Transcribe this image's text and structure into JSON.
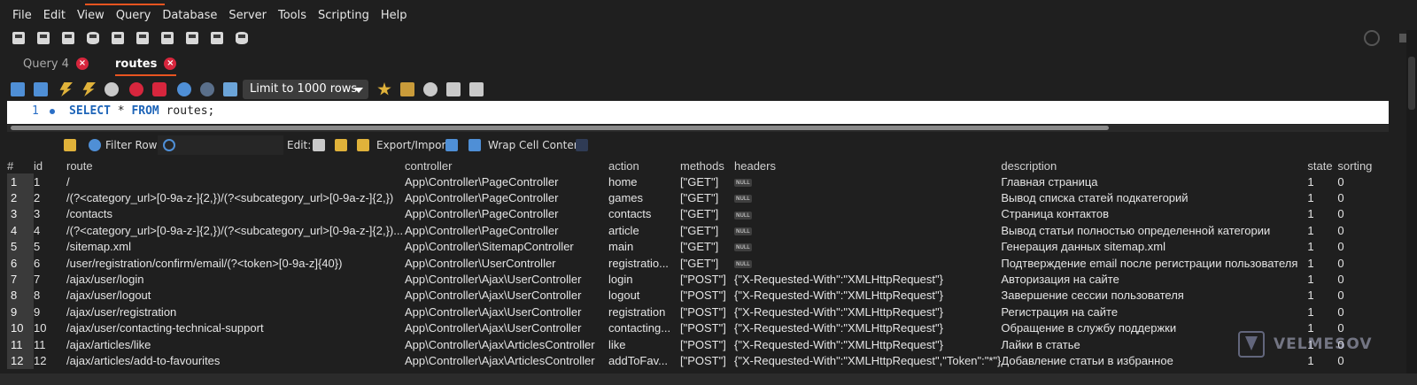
{
  "menu": [
    "File",
    "Edit",
    "View",
    "Query",
    "Database",
    "Server",
    "Tools",
    "Scripting",
    "Help"
  ],
  "main_toolbar_icons": [
    "new-sql-tab-icon",
    "open-sql-icon",
    "inspector-icon",
    "create-schema-icon",
    "create-table-icon",
    "create-view-icon",
    "create-procedure-icon",
    "create-function-icon",
    "search-table-icon",
    "reconnect-icon"
  ],
  "tabs": [
    {
      "label": "Query 4",
      "active": false
    },
    {
      "label": "routes",
      "active": true
    }
  ],
  "query_toolbar": {
    "icons": [
      "open-file-icon",
      "save-file-icon",
      "execute-icon",
      "execute-current-icon",
      "explain-icon",
      "stop-icon",
      "toggle-error-icon",
      "commit-icon",
      "rollback-icon",
      "autocommit-icon"
    ],
    "limit_label": "Limit to 1000 rows",
    "after_icons": [
      "beautify-icon",
      "find-replace-icon",
      "search-icon",
      "invisible-chars-icon",
      "wrap-icon"
    ]
  },
  "editor": {
    "line_number": "1",
    "kw1": "SELECT",
    "star": " * ",
    "kw2": "FROM",
    "rest": " routes;"
  },
  "result_toolbar": {
    "filter_label": "Filter Rows:",
    "edit_label": "Edit:",
    "export_label": "Export/Import:",
    "wrap_label": "Wrap Cell Content:"
  },
  "columns": [
    "#",
    "id",
    "route",
    "controller",
    "action",
    "methods",
    "headers",
    "description",
    "state",
    "sorting"
  ],
  "rows": [
    {
      "n": "1",
      "id": "1",
      "route": "/",
      "controller": "App\\Controller\\PageController",
      "action": "home",
      "methods": "[\"GET\"]",
      "headers": "NULL",
      "description": "Главная страница",
      "state": "1",
      "sorting": "0"
    },
    {
      "n": "2",
      "id": "2",
      "route": "/(?<category_url>[0-9a-z-]{2,})/(?<subcategory_url>[0-9a-z-]{2,})",
      "controller": "App\\Controller\\PageController",
      "action": "games",
      "methods": "[\"GET\"]",
      "headers": "NULL",
      "description": "Вывод списка статей подкатегорий",
      "state": "1",
      "sorting": "0"
    },
    {
      "n": "3",
      "id": "3",
      "route": "/contacts",
      "controller": "App\\Controller\\PageController",
      "action": "contacts",
      "methods": "[\"GET\"]",
      "headers": "NULL",
      "description": "Страница контактов",
      "state": "1",
      "sorting": "0"
    },
    {
      "n": "4",
      "id": "4",
      "route": "/(?<category_url>[0-9a-z-]{2,})/(?<subcategory_url>[0-9a-z-]{2,})...",
      "controller": "App\\Controller\\PageController",
      "action": "article",
      "methods": "[\"GET\"]",
      "headers": "NULL",
      "description": "Вывод статьи полностью определенной категории",
      "state": "1",
      "sorting": "0"
    },
    {
      "n": "5",
      "id": "5",
      "route": "/sitemap.xml",
      "controller": "App\\Controller\\SitemapController",
      "action": "main",
      "methods": "[\"GET\"]",
      "headers": "NULL",
      "description": "Генерация данных sitemap.xml",
      "state": "1",
      "sorting": "0"
    },
    {
      "n": "6",
      "id": "6",
      "route": "/user/registration/confirm/email/(?<token>[0-9a-z]{40})",
      "controller": "App\\Controller\\UserController",
      "action": "registratio...",
      "methods": "[\"GET\"]",
      "headers": "NULL",
      "description": "Подтверждение email после регистрации пользователя",
      "state": "1",
      "sorting": "0"
    },
    {
      "n": "7",
      "id": "7",
      "route": "/ajax/user/login",
      "controller": "App\\Controller\\Ajax\\UserController",
      "action": "login",
      "methods": "[\"POST\"]",
      "headers": "{\"X-Requested-With\":\"XMLHttpRequest\"}",
      "description": "Авторизация на сайте",
      "state": "1",
      "sorting": "0"
    },
    {
      "n": "8",
      "id": "8",
      "route": "/ajax/user/logout",
      "controller": "App\\Controller\\Ajax\\UserController",
      "action": "logout",
      "methods": "[\"POST\"]",
      "headers": "{\"X-Requested-With\":\"XMLHttpRequest\"}",
      "description": "Завершение сессии пользователя",
      "state": "1",
      "sorting": "0"
    },
    {
      "n": "9",
      "id": "9",
      "route": "/ajax/user/registration",
      "controller": "App\\Controller\\Ajax\\UserController",
      "action": "registration",
      "methods": "[\"POST\"]",
      "headers": "{\"X-Requested-With\":\"XMLHttpRequest\"}",
      "description": "Регистрация на сайте",
      "state": "1",
      "sorting": "0"
    },
    {
      "n": "10",
      "id": "10",
      "route": "/ajax/user/contacting-technical-support",
      "controller": "App\\Controller\\Ajax\\UserController",
      "action": "contacting...",
      "methods": "[\"POST\"]",
      "headers": "{\"X-Requested-With\":\"XMLHttpRequest\"}",
      "description": "Обращение в службу поддержки",
      "state": "1",
      "sorting": "0"
    },
    {
      "n": "11",
      "id": "11",
      "route": "/ajax/articles/like",
      "controller": "App\\Controller\\Ajax\\ArticlesController",
      "action": "like",
      "methods": "[\"POST\"]",
      "headers": "{\"X-Requested-With\":\"XMLHttpRequest\"}",
      "description": "Лайки в статье",
      "state": "1",
      "sorting": "0"
    },
    {
      "n": "12",
      "id": "12",
      "route": "/ajax/articles/add-to-favourites",
      "controller": "App\\Controller\\Ajax\\ArticlesController",
      "action": "addToFav...",
      "methods": "[\"POST\"]",
      "headers": "{\"X-Requested-With\":\"XMLHttpRequest\",\"Token\":\"*\"}",
      "description": "Добавление статьи в избранное",
      "state": "1",
      "sorting": "0"
    }
  ],
  "watermark": "VELMESOV",
  "colors": {
    "accent": "#e95420",
    "close": "#d7263d",
    "keyword": "#1d64b8"
  }
}
